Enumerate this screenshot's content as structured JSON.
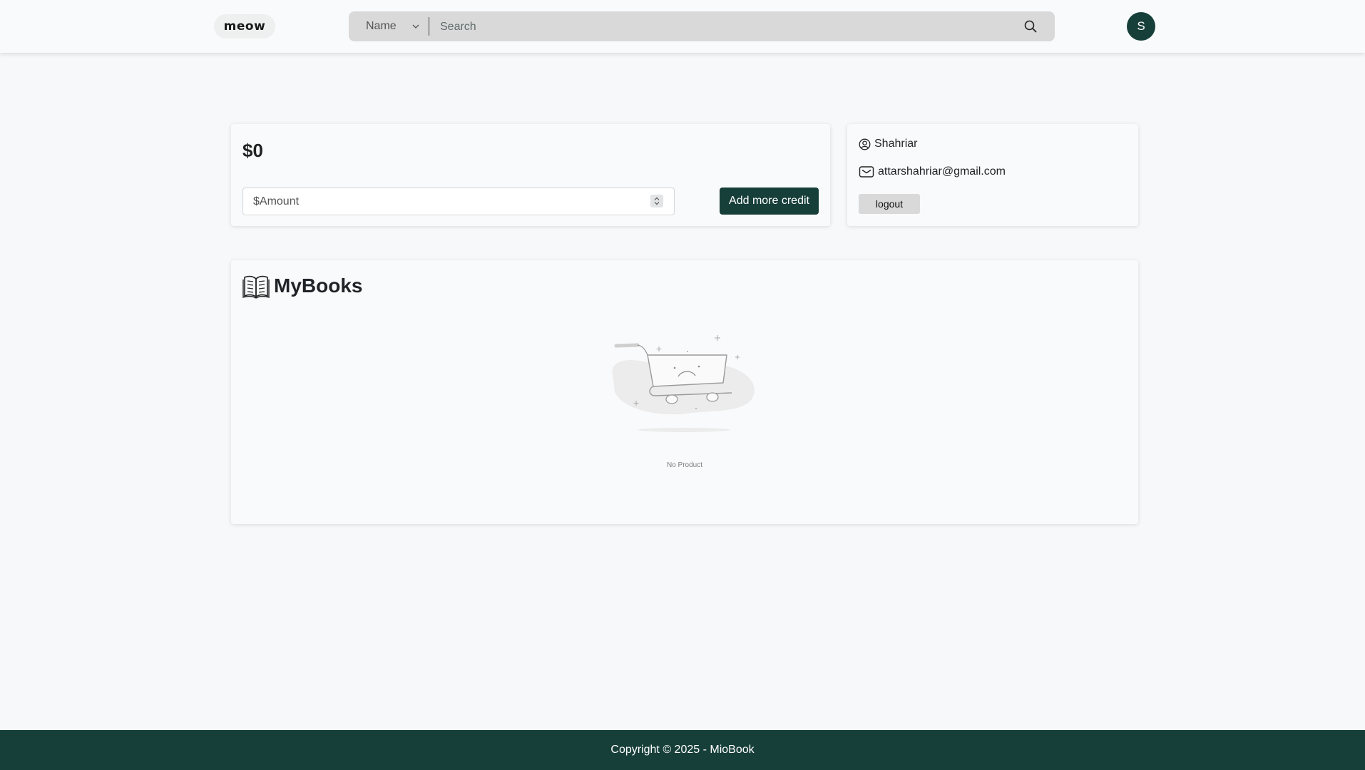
{
  "header": {
    "logo_text": "meow",
    "search": {
      "filter_selected": "Name",
      "placeholder": "Search"
    },
    "avatar_initial": "S"
  },
  "credit": {
    "balance": "$0",
    "amount_placeholder": "$Amount",
    "add_button_label": "Add more credit"
  },
  "profile": {
    "name": "Shahriar",
    "email": "attarshahriar@gmail.com",
    "logout_label": "logout"
  },
  "books": {
    "title": "MyBooks",
    "empty_text": "No Product"
  },
  "footer": {
    "text": "Copyright © 2025 - MioBook"
  },
  "colors": {
    "brand": "#173f3a",
    "background": "#f7f8f9",
    "search_bg": "#d9d9d9"
  }
}
